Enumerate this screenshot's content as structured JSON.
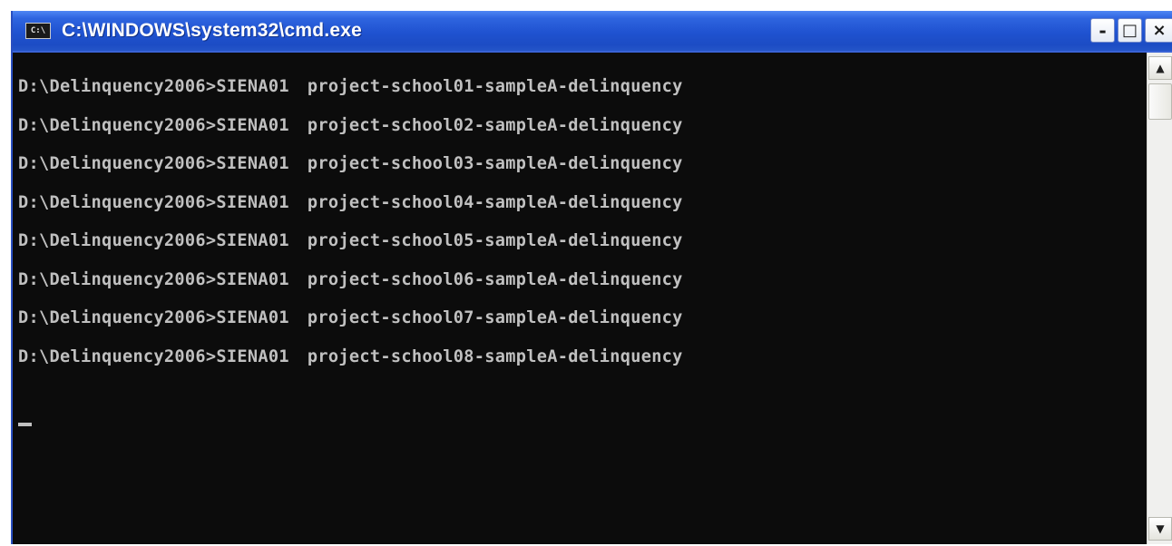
{
  "window": {
    "title": "C:\\WINDOWS\\system32\\cmd.exe",
    "icon_text": "C:\\",
    "icon": "console-icon",
    "buttons": {
      "minimize": "-",
      "maximize": "□",
      "close": "×"
    }
  },
  "console": {
    "lines": [
      {
        "prompt": "D:\\Delinquency2006>",
        "command": "SIENA01",
        "argument": "project-school01-sampleA-delinquency"
      },
      {
        "prompt": "D:\\Delinquency2006>",
        "command": "SIENA01",
        "argument": "project-school02-sampleA-delinquency"
      },
      {
        "prompt": "D:\\Delinquency2006>",
        "command": "SIENA01",
        "argument": "project-school03-sampleA-delinquency"
      },
      {
        "prompt": "D:\\Delinquency2006>",
        "command": "SIENA01",
        "argument": "project-school04-sampleA-delinquency"
      },
      {
        "prompt": "D:\\Delinquency2006>",
        "command": "SIENA01",
        "argument": "project-school05-sampleA-delinquency"
      },
      {
        "prompt": "D:\\Delinquency2006>",
        "command": "SIENA01",
        "argument": "project-school06-sampleA-delinquency"
      },
      {
        "prompt": "D:\\Delinquency2006>",
        "command": "SIENA01",
        "argument": "project-school07-sampleA-delinquency"
      },
      {
        "prompt": "D:\\Delinquency2006>",
        "command": "SIENA01",
        "argument": "project-school08-sampleA-delinquency"
      }
    ],
    "colors": {
      "background": "#0c0c0c",
      "text": "#c0c0c0"
    }
  },
  "scrollbar": {
    "up_arrow": "▲",
    "down_arrow": "▼"
  },
  "theme": {
    "titlebar_color": "#1f52d0"
  }
}
